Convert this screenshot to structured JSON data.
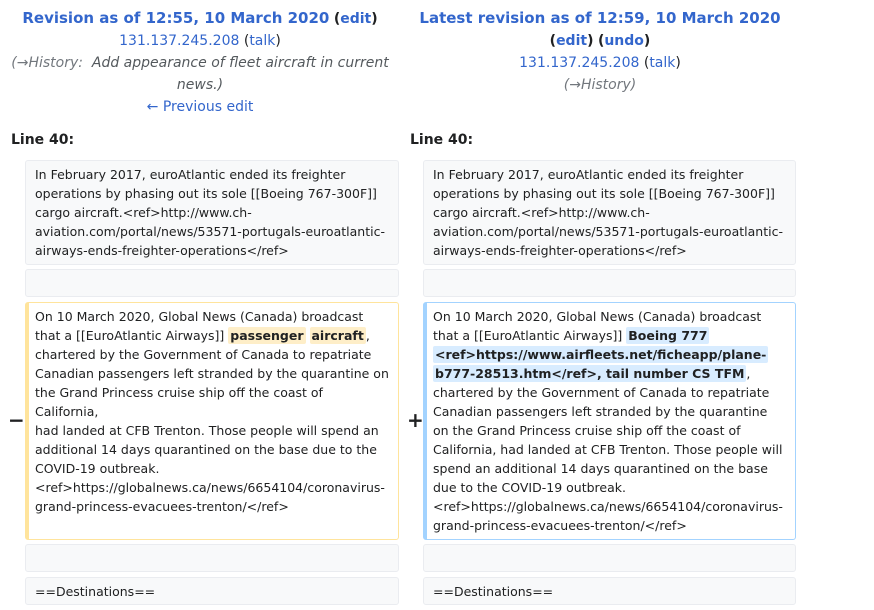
{
  "left": {
    "title": "Revision as of 12:55, 10 March 2020",
    "edit": "edit",
    "user": "131.137.245.208",
    "talk": "talk",
    "history_arrow": "(→History:",
    "comment_line1": "Add appearance of fleet aircraft in current",
    "comment_line2": "news.)",
    "previous_edit": "← Previous edit",
    "line_label": "Line 40:"
  },
  "right": {
    "title": "Latest revision as of 12:59, 10 March 2020",
    "edit": "edit",
    "undo": "undo",
    "user": "131.137.245.208",
    "talk": "talk",
    "history": "(→History)",
    "line_label": "Line 40:"
  },
  "rows": {
    "context1": {
      "l1": "In February 2017, euroAtlantic ended its freighter",
      "l2": "operations by phasing out its sole [[Boeing 767-300F]]",
      "l3": "cargo aircraft.<ref>http://www.ch-",
      "l4": "aviation.com/portal/news/53571-portugals-euroatlantic-",
      "l5": "airways-ends-freighter-operations</ref>"
    },
    "changed_left": {
      "l1": "On 10 March 2020, Global News (Canada) broadcast",
      "l2a": "that a [[EuroAtlantic Airways]] ",
      "l2b": "passenger",
      "l2c": " ",
      "l2d": "aircraft",
      "l2e": ",",
      "l3": "chartered by the Government of Canada to repatriate",
      "l4": "Canadian passengers left stranded by the quarantine on",
      "l5": "the Grand Princess cruise ship off the coast of California,",
      "l6": "had landed at CFB Trenton. Those people will spend an",
      "l7": "additional 14 days quarantined on the base due to the",
      "l8": "COVID-19 outbreak.",
      "l9": "<ref>https://globalnews.ca/news/6654104/coronavirus-",
      "l10": "grand-princess-evacuees-trenton/</ref>"
    },
    "changed_right": {
      "l1": "On 10 March 2020, Global News (Canada) broadcast",
      "l2a": "that a [[EuroAtlantic Airways]] ",
      "l2b": "Boeing 777",
      "l3": "<ref>https://www.airfleets.net/ficheapp/plane-",
      "l4a": "b777-28513.htm</ref>, tail number CS TFM",
      "l4b": ",",
      "l5": "chartered by the Government of Canada to repatriate",
      "l6": "Canadian passengers left stranded by the quarantine",
      "l7": "on the Grand Princess cruise ship off the coast of",
      "l8": "California, had landed at CFB Trenton. Those people will",
      "l9": "spend an additional 14 days quarantined on the base",
      "l10": "due to the COVID-19 outbreak.",
      "l11": "<ref>https://globalnews.ca/news/6654104/coronavirus-",
      "l12": "grand-princess-evacuees-trenton/</ref>"
    },
    "destinations": "==Destinations=="
  },
  "markers": {
    "minus": "−",
    "plus": "+"
  },
  "colors": {
    "link": "#3366cc",
    "deleted_border": "#ffe49c",
    "added_border": "#a3d3ff",
    "deleted_highlight": "#feeec8",
    "added_highlight": "#d8ecff"
  }
}
